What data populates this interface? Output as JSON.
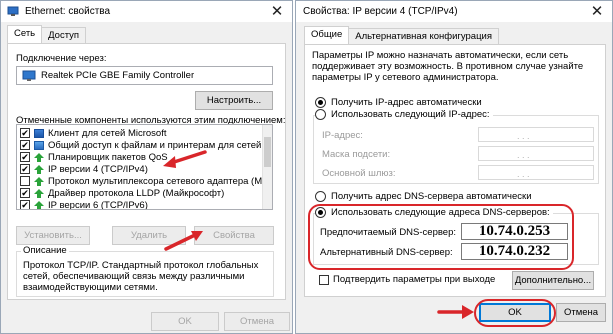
{
  "left_window": {
    "title": "Ethernet: свойства",
    "close_glyph": "✕",
    "tabs": [
      "Сеть",
      "Доступ"
    ],
    "connect_via_label": "Подключение через:",
    "adapter_name": "Realtek PCIe GBE Family Controller",
    "configure_button": "Настроить...",
    "components_label": "Отмеченные компоненты используются этим подключением:",
    "components": [
      {
        "label": "Клиент для сетей Microsoft",
        "checked": true,
        "icon": "network-client-icon"
      },
      {
        "label": "Общий доступ к файлам и принтерам для сетей Mi",
        "checked": true,
        "icon": "file-sharing-icon"
      },
      {
        "label": "Планировщик пакетов QoS",
        "checked": true,
        "icon": "qos-icon"
      },
      {
        "label": "IP версии 4 (TCP/IPv4)",
        "checked": true,
        "icon": "protocol-icon"
      },
      {
        "label": "Протокол мультиплексора сетевого адаптера (Ma",
        "checked": false,
        "icon": "protocol-icon"
      },
      {
        "label": "Драйвер протокола LLDP (Майкрософт)",
        "checked": true,
        "icon": "protocol-icon"
      },
      {
        "label": "IP версии 6 (TCP/IPv6)",
        "checked": true,
        "icon": "protocol-icon"
      }
    ],
    "install_button": "Установить...",
    "remove_button": "Удалить",
    "properties_button": "Свойства",
    "description_title": "Описание",
    "description_text": "Протокол TCP/IP. Стандартный протокол глобальных сетей, обеспечивающий связь между различными взаимодействующими сетями.",
    "ok_button": "OK",
    "cancel_button": "Отмена"
  },
  "right_window": {
    "title": "Свойства: IP версии 4 (TCP/IPv4)",
    "close_glyph": "✕",
    "tabs": [
      "Общие",
      "Альтернативная конфигурация"
    ],
    "intro_text": "Параметры IP можно назначать автоматически, если сеть поддерживает эту возможность. В противном случае узнайте параметры IP у сетевого администратора.",
    "ip_auto_label": "Получить IP-адрес автоматически",
    "ip_manual_label": "Использовать следующий IP-адрес:",
    "ip_address_label": "IP-адрес:",
    "subnet_mask_label": "Маска подсети:",
    "gateway_label": "Основной шлюз:",
    "ip_dots": ".   .   .",
    "dns_auto_label": "Получить адрес DNS-сервера автоматически",
    "dns_manual_label": "Использовать следующие адреса DNS-серверов:",
    "preferred_dns_label": "Предпочитаемый DNS-сервер:",
    "preferred_dns_value": "10.74.0.253",
    "alternate_dns_label": "Альтернативный DNS-сервер:",
    "alternate_dns_value": "10.74.0.232",
    "validate_label": "Подтвердить параметры при выходе",
    "advanced_button": "Дополнительно...",
    "ok_button": "OK",
    "cancel_button": "Отмена",
    "selected": {
      "ip_mode": "auto",
      "dns_mode": "manual",
      "validate_on_exit": false
    }
  },
  "colors": {
    "highlight_red": "#d9262a",
    "focus_blue": "#0078d7"
  }
}
